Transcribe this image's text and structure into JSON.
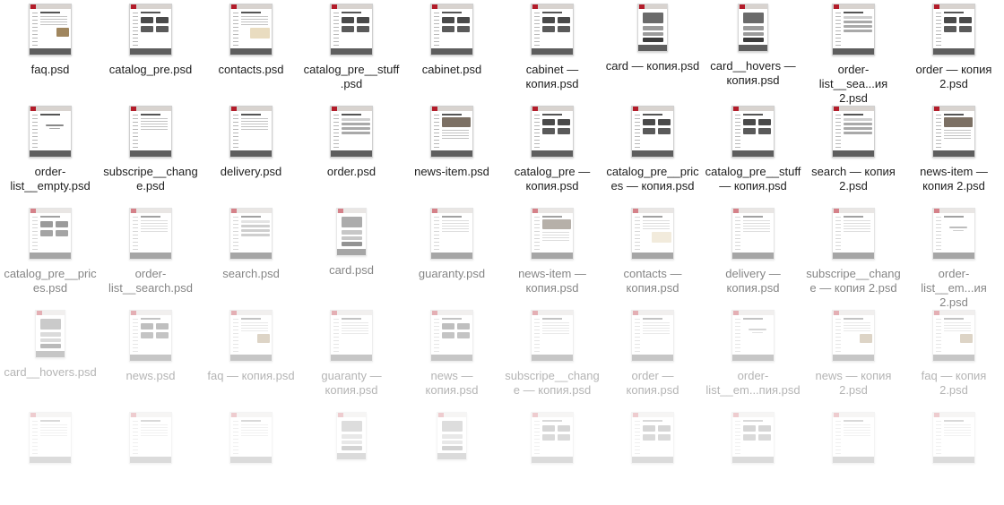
{
  "files": [
    {
      "name": "faq.psd",
      "layout": "text-image"
    },
    {
      "name": "catalog_pre.psd",
      "layout": "catalog"
    },
    {
      "name": "contacts.psd",
      "layout": "contacts"
    },
    {
      "name": "catalog_pre__stuff.psd",
      "layout": "catalog"
    },
    {
      "name": "cabinet.psd",
      "layout": "catalog"
    },
    {
      "name": "cabinet — копия.psd",
      "layout": "catalog"
    },
    {
      "name": "card — копия.psd",
      "layout": "card"
    },
    {
      "name": "card__hovers — копия.psd",
      "layout": "card"
    },
    {
      "name": "order-list__sea...ия 2.psd",
      "layout": "list"
    },
    {
      "name": "order — копия 2.psd",
      "layout": "catalog"
    },
    {
      "name": "order-list__empty.psd",
      "layout": "empty"
    },
    {
      "name": "subscripe__change.psd",
      "layout": "text"
    },
    {
      "name": "delivery.psd",
      "layout": "text"
    },
    {
      "name": "order.psd",
      "layout": "list"
    },
    {
      "name": "news-item.psd",
      "layout": "banner"
    },
    {
      "name": "catalog_pre — копия.psd",
      "layout": "catalog"
    },
    {
      "name": "catalog_pre__prices — копия.psd",
      "layout": "catalog"
    },
    {
      "name": "catalog_pre__stuff — копия.psd",
      "layout": "catalog"
    },
    {
      "name": "search — копия 2.psd",
      "layout": "list"
    },
    {
      "name": "news-item — копия 2.psd",
      "layout": "banner"
    },
    {
      "name": "catalog_pre__prices.psd",
      "layout": "catalog"
    },
    {
      "name": "order-list__search.psd",
      "layout": "text"
    },
    {
      "name": "search.psd",
      "layout": "list"
    },
    {
      "name": "card.psd",
      "layout": "card"
    },
    {
      "name": "guaranty.psd",
      "layout": "text"
    },
    {
      "name": "news-item — копия.psd",
      "layout": "banner"
    },
    {
      "name": "contacts — копия.psd",
      "layout": "contacts"
    },
    {
      "name": "delivery — копия.psd",
      "layout": "text"
    },
    {
      "name": "subscripe__change — копия 2.psd",
      "layout": "text"
    },
    {
      "name": "order-list__em...ия 2.psd",
      "layout": "empty"
    },
    {
      "name": "card__hovers.psd",
      "layout": "card"
    },
    {
      "name": "news.psd",
      "layout": "catalog"
    },
    {
      "name": "faq — копия.psd",
      "layout": "text-image"
    },
    {
      "name": "guaranty — копия.psd",
      "layout": "text"
    },
    {
      "name": "news — копия.psd",
      "layout": "catalog"
    },
    {
      "name": "subscripe__change — копия.psd",
      "layout": "text"
    },
    {
      "name": "order — копия.psd",
      "layout": "text"
    },
    {
      "name": "order-list__em...пия.psd",
      "layout": "empty"
    },
    {
      "name": "news — копия 2.psd",
      "layout": "text-image"
    },
    {
      "name": "faq — копия 2.psd",
      "layout": "text-image"
    },
    {
      "name": "",
      "layout": "text"
    },
    {
      "name": "",
      "layout": "text"
    },
    {
      "name": "",
      "layout": "text"
    },
    {
      "name": "",
      "layout": "card"
    },
    {
      "name": "",
      "layout": "card"
    },
    {
      "name": "",
      "layout": "catalog"
    },
    {
      "name": "",
      "layout": "catalog"
    },
    {
      "name": "",
      "layout": "catalog"
    },
    {
      "name": "",
      "layout": "text"
    },
    {
      "name": "",
      "layout": "text"
    }
  ],
  "colors": {
    "accent": "#b31c2a",
    "footer": "#5e5e5e",
    "label": "#1e1e1e",
    "label_faded": "#9c9c9c"
  },
  "icon": "psd-document-icon"
}
